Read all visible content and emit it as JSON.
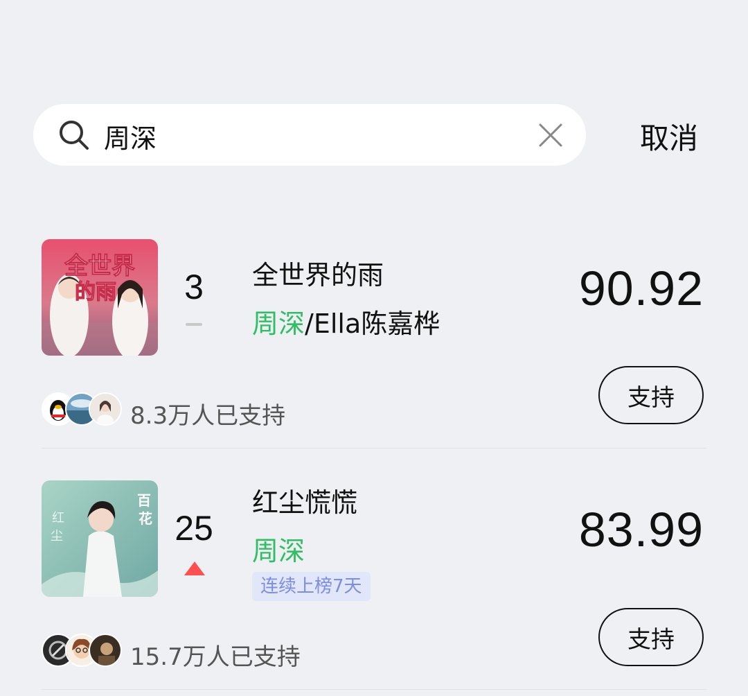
{
  "search": {
    "query": "周深",
    "cancel_label": "取消"
  },
  "songs": [
    {
      "rank": "3",
      "rank_change": "flat",
      "title": "全世界的雨",
      "artist_highlight": "周深",
      "artist_rest": "/Ella陈嘉桦",
      "score": "90.92",
      "support_count": "8.3万人已支持",
      "support_label": "支持",
      "streak_badge": ""
    },
    {
      "rank": "25",
      "rank_change": "up",
      "title": "红尘慌慌",
      "artist_highlight": "周深",
      "artist_rest": "",
      "score": "83.99",
      "support_count": "15.7万人已支持",
      "support_label": "支持",
      "streak_badge": "连续上榜7天"
    }
  ],
  "colors": {
    "background": "#eef0f4",
    "artist_highlight": "#2fbf62",
    "rank_up": "#ff4f4f",
    "badge_bg": "#e1e6f9",
    "badge_text": "#7c8ee0"
  }
}
